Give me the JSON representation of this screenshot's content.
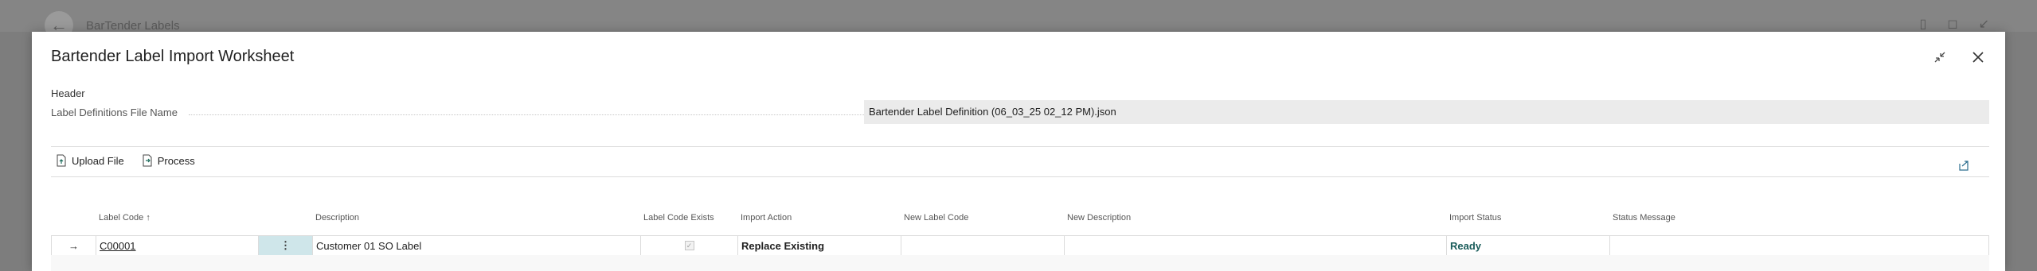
{
  "background": {
    "title": "BarTender Labels"
  },
  "dialog": {
    "title": "Bartender Label Import Worksheet"
  },
  "header": {
    "section_label": "Header",
    "file_name_label": "Label Definitions File Name",
    "file_name_value": "Bartender Label Definition (06_03_25 02_12 PM).json"
  },
  "toolbar": {
    "upload_label": "Upload File",
    "process_label": "Process"
  },
  "grid": {
    "columns": {
      "label_code": "Label Code",
      "sort_arrow": "↑",
      "description": "Description",
      "label_code_exists": "Label Code Exists",
      "import_action": "Import Action",
      "new_label_code": "New Label Code",
      "new_description": "New Description",
      "import_status": "Import Status",
      "status_message": "Status Message"
    },
    "rows": [
      {
        "label_code": "C00001",
        "description": "Customer 01 SO Label",
        "label_code_exists": true,
        "import_action": "Replace Existing",
        "new_label_code": "",
        "new_description": "",
        "import_status": "Ready",
        "status_message": ""
      }
    ]
  },
  "colors": {
    "status_ready": "#1a5c5a",
    "selected_cell": "#cfe6ea"
  }
}
